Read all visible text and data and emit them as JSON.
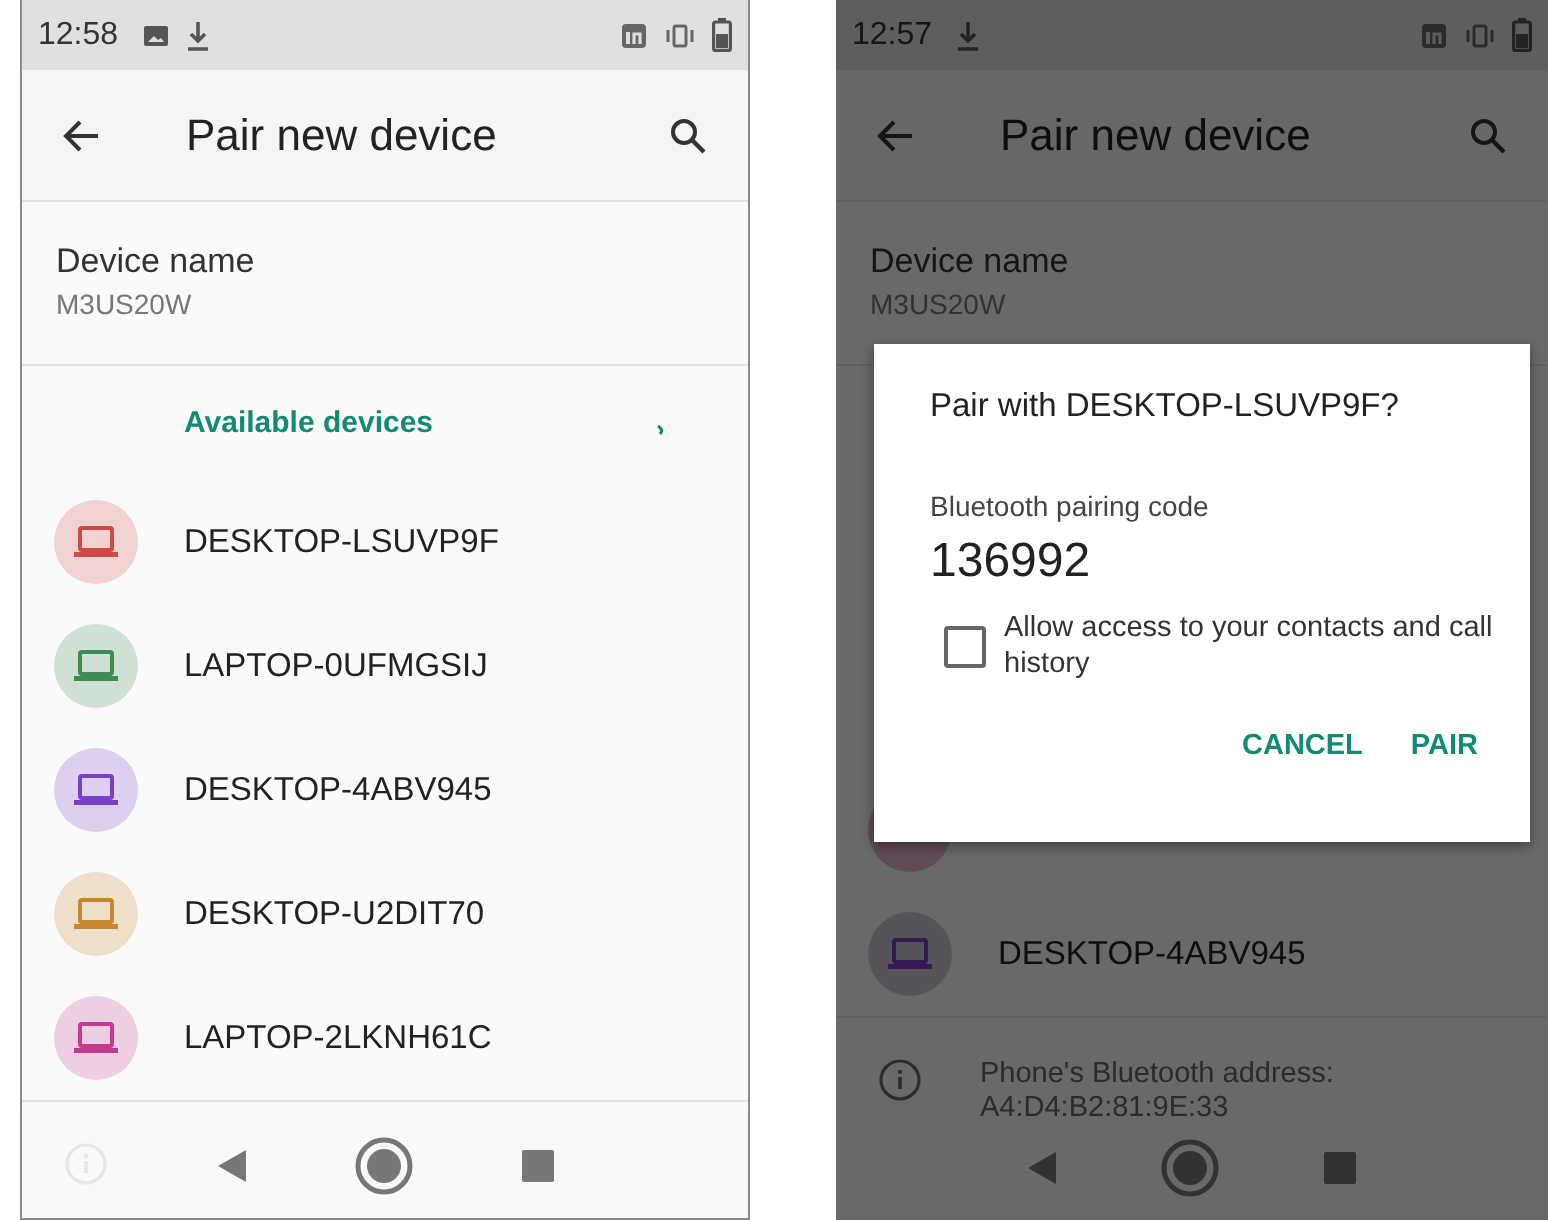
{
  "phones": [
    {
      "status_bar": {
        "time": "12:58",
        "notifications": [
          {
            "kind": "image"
          },
          {
            "kind": "download"
          }
        ]
      },
      "app_bar": {
        "title": "Pair new device"
      },
      "device_name": {
        "label": "Device name",
        "value": "M3US20W"
      },
      "section_header": "Available devices",
      "devices": [
        {
          "name": "DESKTOP-LSUVP9F",
          "color": "#d04a45"
        },
        {
          "name": "LAPTOP-0UFMGSIJ",
          "color": "#3d8a55"
        },
        {
          "name": "DESKTOP-4ABV945",
          "color": "#7b3fc7"
        },
        {
          "name": "DESKTOP-U2DIT70",
          "color": "#c8862d"
        },
        {
          "name": "LAPTOP-2LKNH61C",
          "color": "#c23b8f"
        }
      ]
    },
    {
      "status_bar": {
        "time": "12:57",
        "notifications": [
          {
            "kind": "download"
          }
        ]
      },
      "app_bar": {
        "title": "Pair new device"
      },
      "device_name": {
        "label": "Device name",
        "value": "M3US20W"
      },
      "devices": [
        {
          "kind": "hidden"
        },
        {
          "kind": "device",
          "name": "DESKTOP-4ABV945",
          "color": "#341a54"
        }
      ],
      "info": [
        "Phone's Bluetooth address:",
        "A4:D4:B2:81:9E:33"
      ],
      "dialog": {
        "title": "Pair with DESKTOP-LSUVP9F?",
        "code_label": "Bluetooth pairing code",
        "code": "136992",
        "checkbox": {
          "label": "Allow access to your contacts and call history",
          "checked": false
        },
        "buttons": [
          "CANCEL",
          "PAIR"
        ]
      }
    }
  ]
}
